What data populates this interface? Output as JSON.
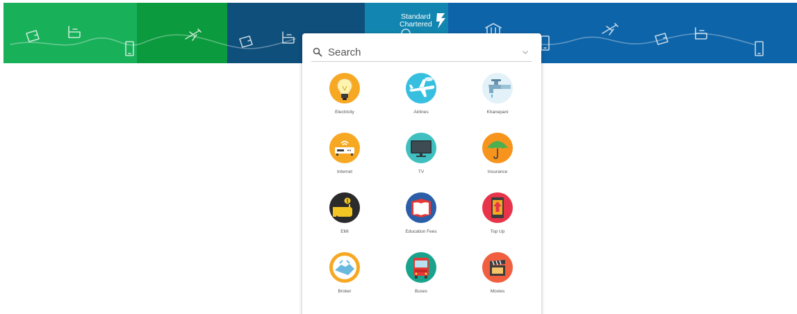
{
  "brand": {
    "name": "Standard\nChartered",
    "icon": "sc-logo-icon"
  },
  "colors": {
    "banner_green_light": "#19b05a",
    "banner_green_dark": "#0c9a3e",
    "banner_navy": "#0f4f7c",
    "banner_teal": "#1286b0",
    "banner_blue": "#0e64a8",
    "card_bg": "#ffffff",
    "text_muted": "#555555"
  },
  "search": {
    "placeholder": "Search",
    "value": ""
  },
  "categories": [
    {
      "label": "Electricity",
      "icon": "lightbulb-icon"
    },
    {
      "label": "Airlines",
      "icon": "airplane-icon"
    },
    {
      "label": "Khanepani",
      "icon": "water-tap-icon"
    },
    {
      "label": "Internet",
      "icon": "router-icon"
    },
    {
      "label": "TV",
      "icon": "tv-icon"
    },
    {
      "label": "Insurance",
      "icon": "umbrella-icon"
    },
    {
      "label": "EMI",
      "icon": "hand-coin-icon"
    },
    {
      "label": "Education Fees",
      "icon": "book-icon"
    },
    {
      "label": "Top Up",
      "icon": "mobile-topup-icon"
    },
    {
      "label": "Broker",
      "icon": "handshake-icon"
    },
    {
      "label": "Buses",
      "icon": "bus-icon"
    },
    {
      "label": "Movies",
      "icon": "clapperboard-icon"
    }
  ]
}
